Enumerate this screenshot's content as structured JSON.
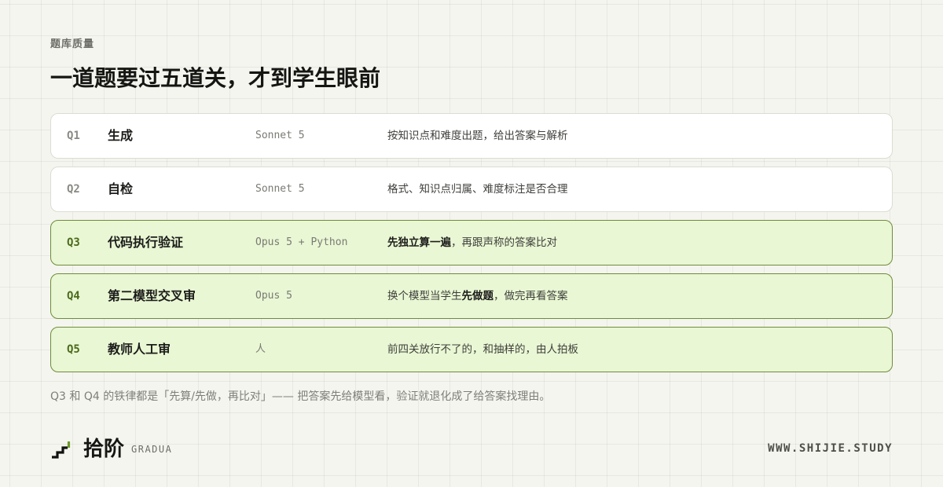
{
  "eyebrow": "题库质量",
  "title": "一道题要过五道关，才到学生眼前",
  "rows": [
    {
      "id": "Q1",
      "name": "生成",
      "model": "Sonnet 5",
      "desc_pre": "按知识点和难度出题，给出答案与解析",
      "desc_bold": "",
      "desc_post": ""
    },
    {
      "id": "Q2",
      "name": "自检",
      "model": "Sonnet 5",
      "desc_pre": "格式、知识点归属、难度标注是否合理",
      "desc_bold": "",
      "desc_post": ""
    },
    {
      "id": "Q3",
      "name": "代码执行验证",
      "model": "Opus 5 + Python",
      "desc_pre": "",
      "desc_bold": "先独立算一遍",
      "desc_post": "，再跟声称的答案比对"
    },
    {
      "id": "Q4",
      "name": "第二模型交叉审",
      "model": "Opus 5",
      "desc_pre": "换个模型当学生",
      "desc_bold": "先做题",
      "desc_post": "，做完再看答案"
    },
    {
      "id": "Q5",
      "name": "教师人工审",
      "model": "人",
      "desc_pre": "前四关放行不了的，和抽样的，由人拍板",
      "desc_bold": "",
      "desc_post": ""
    }
  ],
  "note": "Q3 和 Q4 的铁律都是「先算/先做，再比对」—— 把答案先给模型看，验证就退化成了给答案找理由。",
  "footer": {
    "brand": "拾阶",
    "brand_sub": "GRADUA",
    "logo_icon": "stairs-icon",
    "url": "WWW.SHIJIE.STUDY"
  },
  "colors": {
    "background": "#f5f5ef",
    "highlight_bg": "#e9f7d4",
    "highlight_border": "#6e8c3a",
    "accent_green": "#6a9a2a"
  }
}
